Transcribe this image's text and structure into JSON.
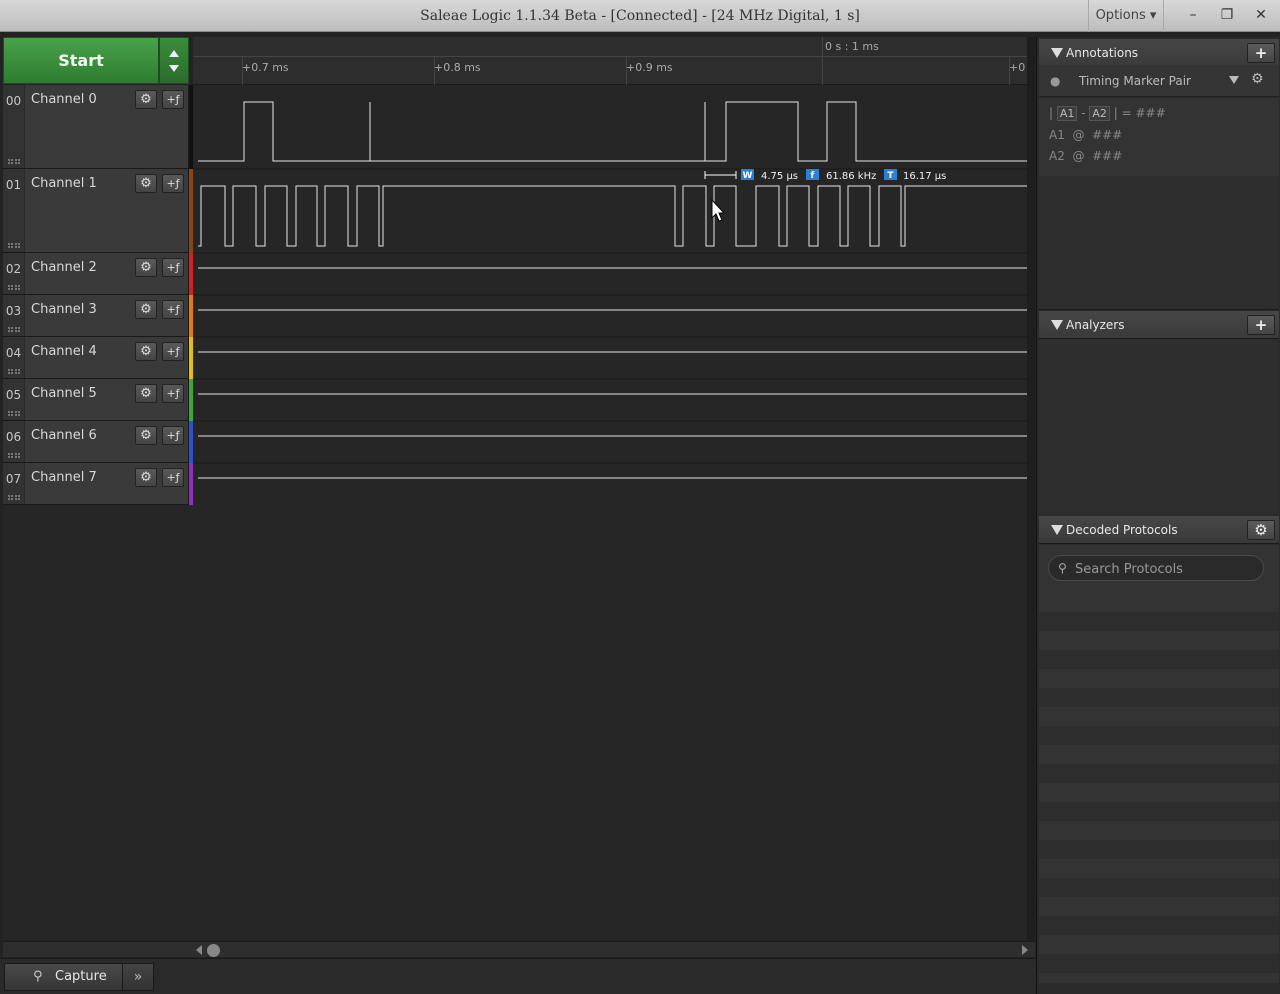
{
  "window": {
    "title": "Saleae Logic 1.1.34 Beta - [Connected] - [24 MHz Digital, 1 s]",
    "options_label": "Options ▾",
    "minimize": "–",
    "restore": "❐",
    "close": "✕"
  },
  "capture": {
    "start_label": "Start"
  },
  "channels": [
    {
      "num": "00",
      "name": "Channel 0",
      "color": "#111111"
    },
    {
      "num": "01",
      "name": "Channel 1",
      "color": "#8b4513"
    },
    {
      "num": "02",
      "name": "Channel 2",
      "color": "#d62020"
    },
    {
      "num": "03",
      "name": "Channel 3",
      "color": "#e07a12"
    },
    {
      "num": "04",
      "name": "Channel 4",
      "color": "#e0c010"
    },
    {
      "num": "05",
      "name": "Channel 5",
      "color": "#3aa83a"
    },
    {
      "num": "06",
      "name": "Channel 6",
      "color": "#3050d0"
    },
    {
      "num": "07",
      "name": "Channel 7",
      "color": "#9030c0"
    }
  ],
  "ruler": {
    "reference": "0 s : 1 ms",
    "ticks": [
      "+0.7 ms",
      "+0.8 ms",
      "+0.9 ms",
      "+0"
    ]
  },
  "measurement": {
    "width_label": "W",
    "width": "4.75 μs",
    "freq_label": "f",
    "frequency": "61.86 kHz",
    "period_label": "T",
    "period": "16.17 μs"
  },
  "annotations": {
    "title": "Annotations",
    "add": "+",
    "marker_type": "Timing Marker Pair",
    "line1": {
      "a1": "A1",
      "a2": "A2",
      "pre": "|",
      "mid": "-",
      "post": "| = ###"
    },
    "line2": "A1  @  ###",
    "line3": "A2  @  ###"
  },
  "analyzers": {
    "title": "Analyzers",
    "add": "+"
  },
  "decoded": {
    "title": "Decoded Protocols",
    "search_placeholder": "Search Protocols"
  },
  "bottom": {
    "capture_tab": "Capture",
    "expand": "»"
  },
  "icons": {
    "gear": "⚙",
    "trigger": "+ƒ",
    "pin": "▼",
    "search": "⚲"
  }
}
